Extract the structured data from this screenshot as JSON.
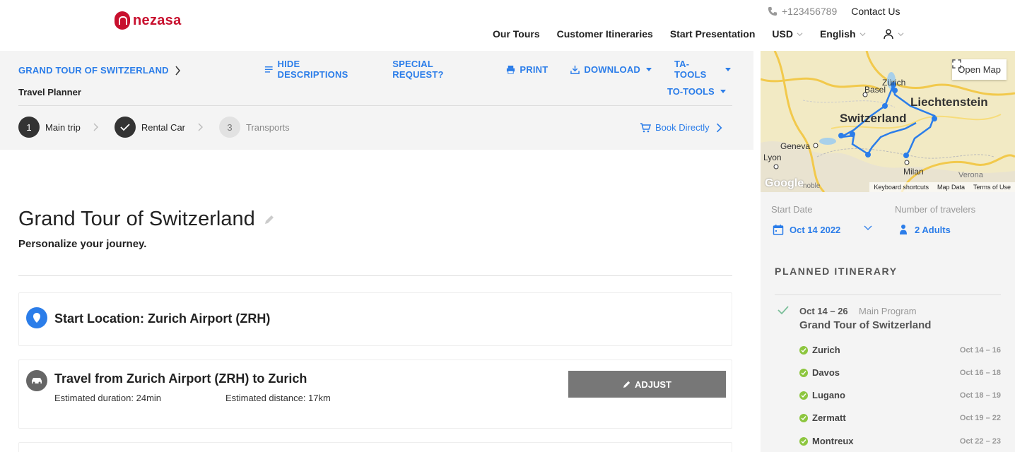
{
  "header": {
    "logo_text": "nezasa",
    "phone": "+123456789",
    "contact": "Contact Us",
    "nav": {
      "tours": "Our Tours",
      "itineraries": "Customer Itineraries",
      "presentation": "Start Presentation",
      "currency": "USD",
      "language": "English"
    }
  },
  "toolbar": {
    "breadcrumb": "GRAND TOUR OF SWITZERLAND",
    "sub": "Travel Planner",
    "hide_descriptions": "HIDE DESCRIPTIONS",
    "special_request": "SPECIAL REQUEST?",
    "print": "PRINT",
    "download": "DOWNLOAD",
    "ta_tools": "TA-TOOLS",
    "to_tools": "TO-TOOLS",
    "steps": [
      {
        "number": "1",
        "label": "Main trip"
      },
      {
        "number": "",
        "label": "Rental Car"
      },
      {
        "number": "3",
        "label": "Transports"
      }
    ],
    "book": "Book Directly"
  },
  "main": {
    "title": "Grand Tour of Switzerland",
    "subtitle": "Personalize your journey.",
    "start_location": "Start Location: Zurich Airport (ZRH)",
    "travel": {
      "title": "Travel from Zurich Airport (ZRH) to Zurich",
      "duration": "Estimated duration: 24min",
      "distance": "Estimated distance: 17km",
      "adjust": "ADJUST"
    }
  },
  "sidebar": {
    "map": {
      "open_map": "Open Map",
      "labels": {
        "basel": "Basel",
        "zurich": "Zürich",
        "switzerland": "Switzerland",
        "liechtenstein": "Liechtenstein",
        "geneva": "Geneva",
        "lyon": "Lyon",
        "milan": "Milan",
        "verona": "Verona",
        "grenoble": "noble",
        "google": "Google"
      },
      "footer": {
        "shortcuts": "Keyboard shortcuts",
        "data": "Map Data",
        "terms": "Terms of Use"
      }
    },
    "start_date_label": "Start Date",
    "start_date": "Oct 14 2022",
    "travelers_label": "Number of travelers",
    "travelers": "2 Adults",
    "planned_title": "PLANNED ITINERARY",
    "program": {
      "dates": "Oct 14 – 26",
      "type": "Main Program",
      "name": "Grand Tour of Switzerland"
    },
    "stops": [
      {
        "name": "Zurich",
        "dates": "Oct 14 – 16"
      },
      {
        "name": "Davos",
        "dates": "Oct 16 – 18"
      },
      {
        "name": "Lugano",
        "dates": "Oct 18 – 19"
      },
      {
        "name": "Zermatt",
        "dates": "Oct 19 – 22"
      },
      {
        "name": "Montreux",
        "dates": "Oct 22 – 23"
      }
    ]
  },
  "colors": {
    "accent": "#2b7de9",
    "brand": "#c8102e",
    "success": "#8dc63f"
  }
}
